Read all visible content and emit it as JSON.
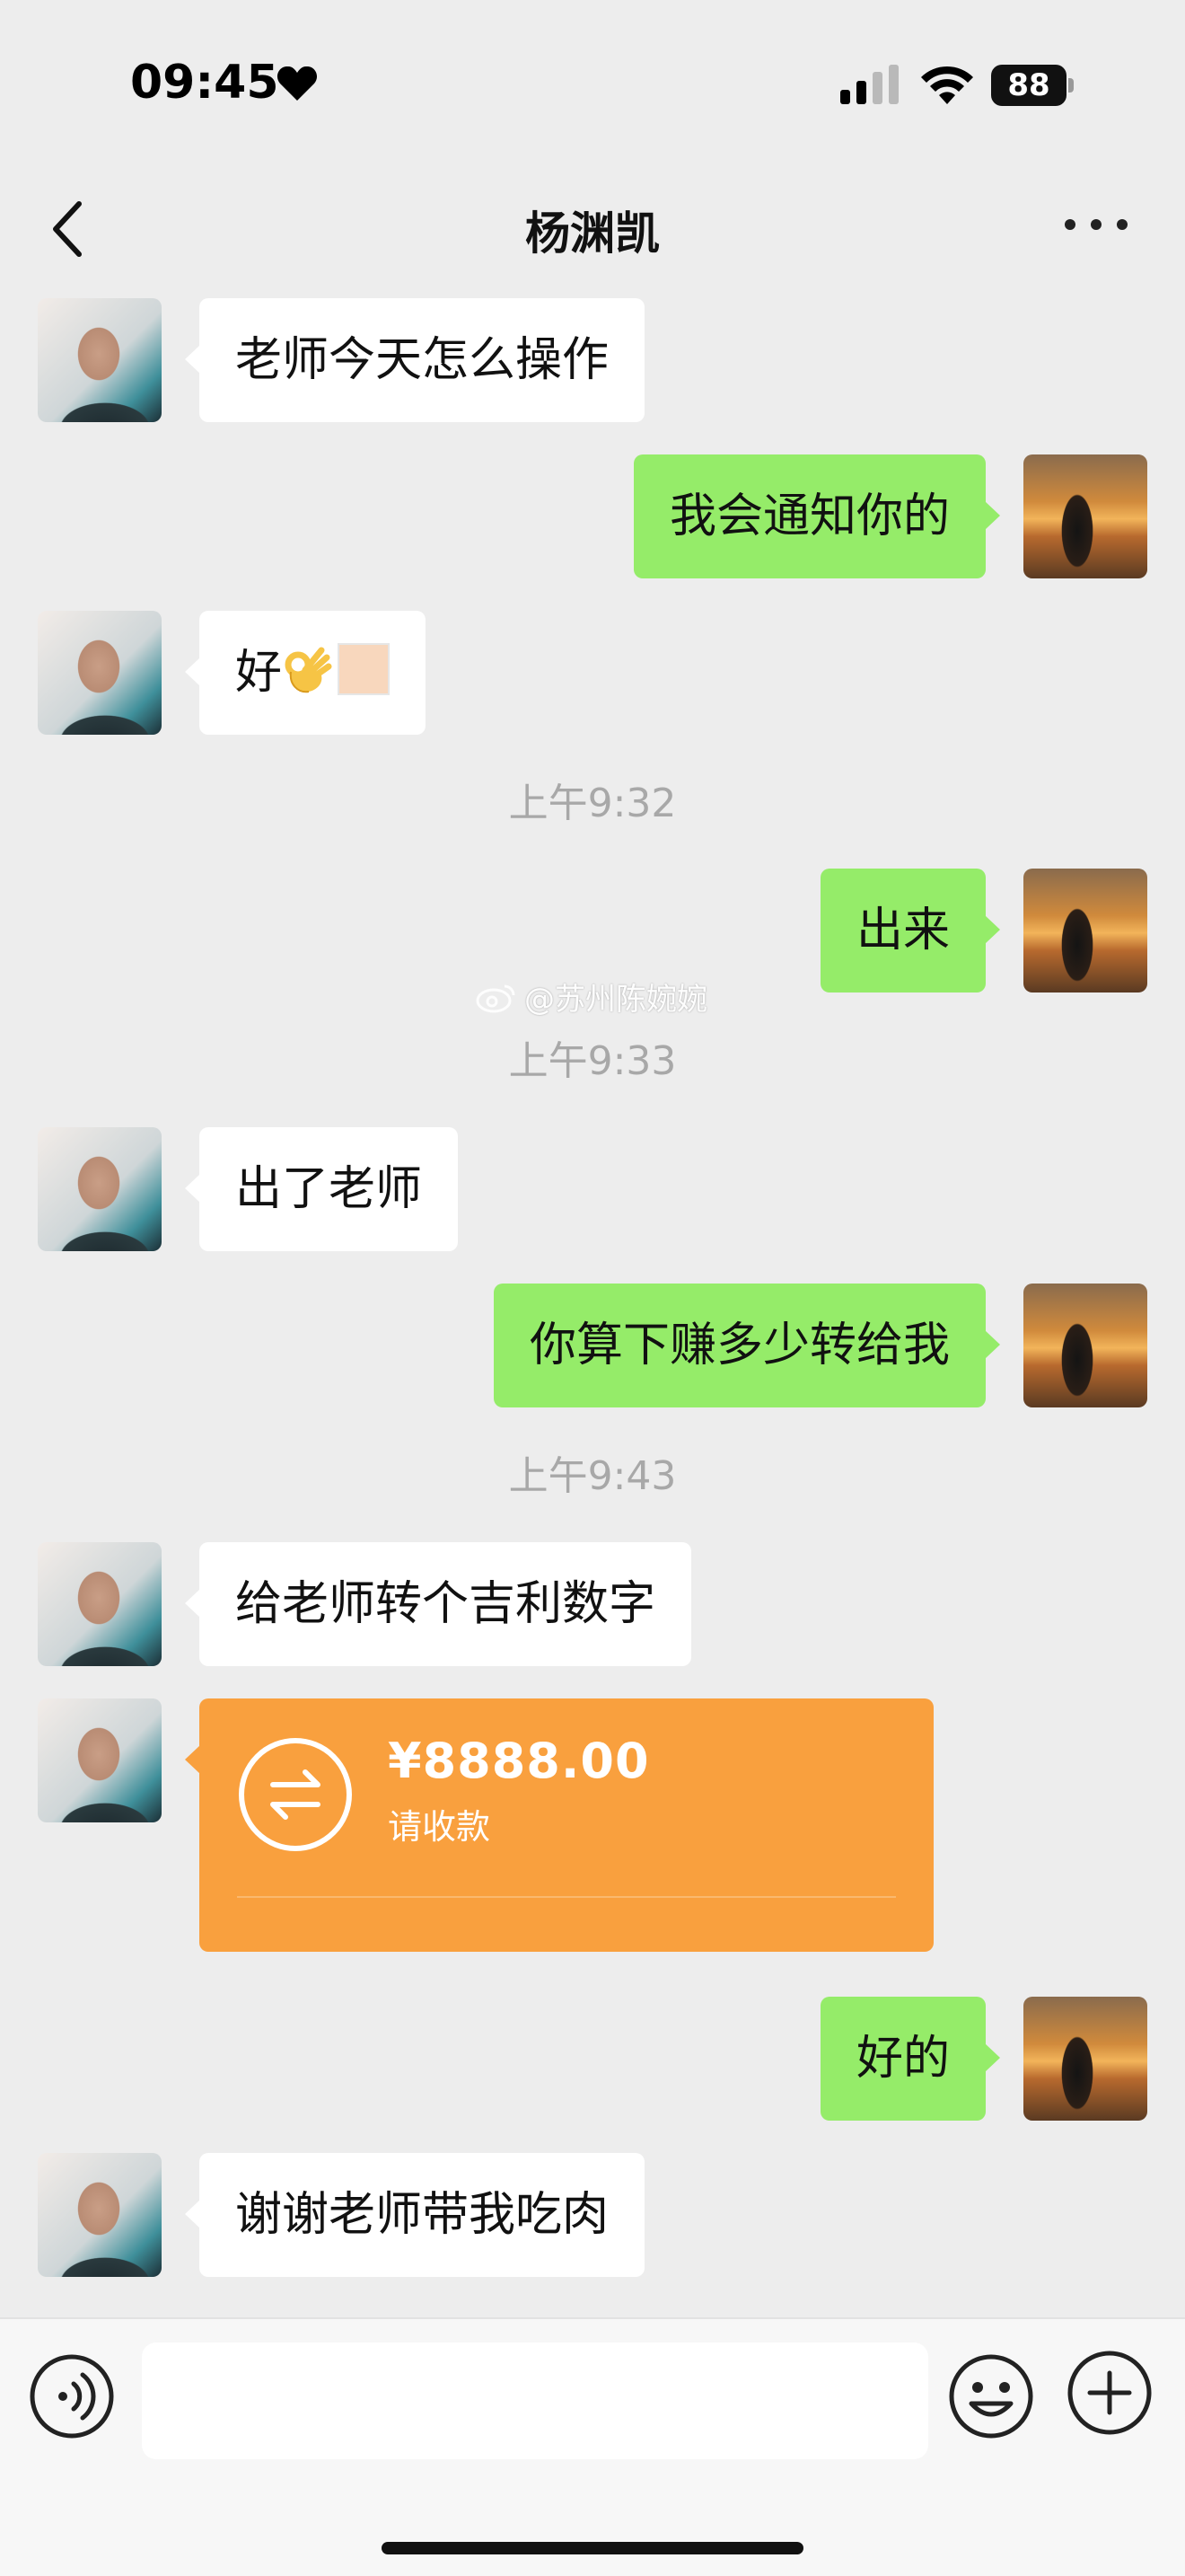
{
  "status_bar": {
    "time": "09:45",
    "battery": "88"
  },
  "header": {
    "title": "杨渊凯"
  },
  "messages": [
    {
      "side": "left",
      "text": "老师今天怎么操作"
    },
    {
      "side": "right",
      "text": "我会通知你的"
    },
    {
      "side": "left",
      "text": "好"
    },
    {
      "type": "time",
      "text": "上午9:32"
    },
    {
      "side": "right",
      "text": "出来"
    },
    {
      "type": "time",
      "text": "上午9:33"
    },
    {
      "side": "left",
      "text": "出了老师"
    },
    {
      "side": "right",
      "text": "你算下赚多少转给我"
    },
    {
      "type": "time",
      "text": "上午9:43"
    },
    {
      "side": "left",
      "text": "给老师转个吉利数字"
    },
    {
      "side": "left",
      "type": "transfer",
      "amount": "¥8888.00",
      "status": "请收款"
    },
    {
      "side": "right",
      "text": "好的"
    },
    {
      "side": "left",
      "text": "谢谢老师带我吃肉"
    }
  ],
  "watermark": "@苏州陈婉婉",
  "icons": {
    "back": "chevron-left-icon",
    "more": "more-dots-icon",
    "voice": "voice-icon",
    "emoji": "smiley-icon",
    "plus": "plus-icon",
    "transfer": "transfer-arrows-icon"
  },
  "colors": {
    "background": "#ededed",
    "incoming_bubble": "#ffffff",
    "outgoing_bubble": "#95ec69",
    "transfer_card": "#f9a03e",
    "timestamp": "#a8a8a8"
  }
}
